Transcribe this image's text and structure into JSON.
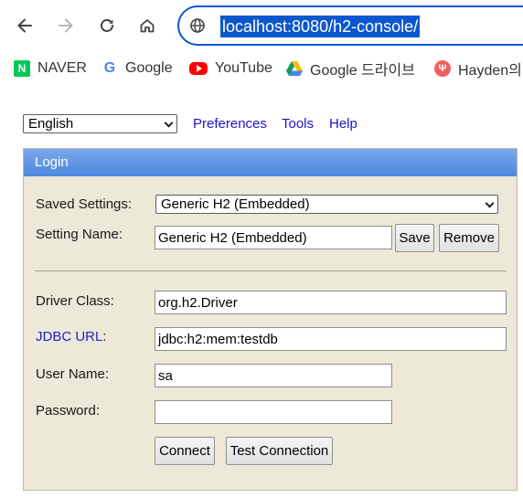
{
  "browser": {
    "url": "localhost:8080/h2-console/",
    "bookmarks": [
      {
        "label": "NAVER",
        "icon": "naver-icon",
        "glyph": "N"
      },
      {
        "label": "Google",
        "icon": "google-icon",
        "glyph": "G"
      },
      {
        "label": "YouTube",
        "icon": "youtube-icon"
      },
      {
        "label": "Google 드라이브",
        "icon": "google-drive-icon"
      },
      {
        "label": "Hayden의",
        "icon": "hayden-icon",
        "glyph": "Ψ"
      }
    ],
    "accent": "#0b57d0"
  },
  "topbar": {
    "language": "English",
    "links": [
      "Preferences",
      "Tools",
      "Help"
    ]
  },
  "login": {
    "title": "Login",
    "header_color": "#5b91e2",
    "panel_color": "#ece9d8",
    "saved_settings_label": "Saved Settings:",
    "saved_settings_value": "Generic H2 (Embedded)",
    "setting_name_label": "Setting Name:",
    "setting_name_value": "Generic H2 (Embedded)",
    "save_label": "Save",
    "remove_label": "Remove",
    "driver_class_label": "Driver Class:",
    "driver_class_value": "org.h2.Driver",
    "jdbc_url_label": "JDBC URL",
    "jdbc_url_colon": ":",
    "jdbc_url_value": "jdbc:h2:mem:testdb",
    "user_name_label": "User Name:",
    "user_name_value": "sa",
    "password_label": "Password:",
    "password_value": "",
    "connect_label": "Connect",
    "test_connection_label": "Test Connection"
  }
}
